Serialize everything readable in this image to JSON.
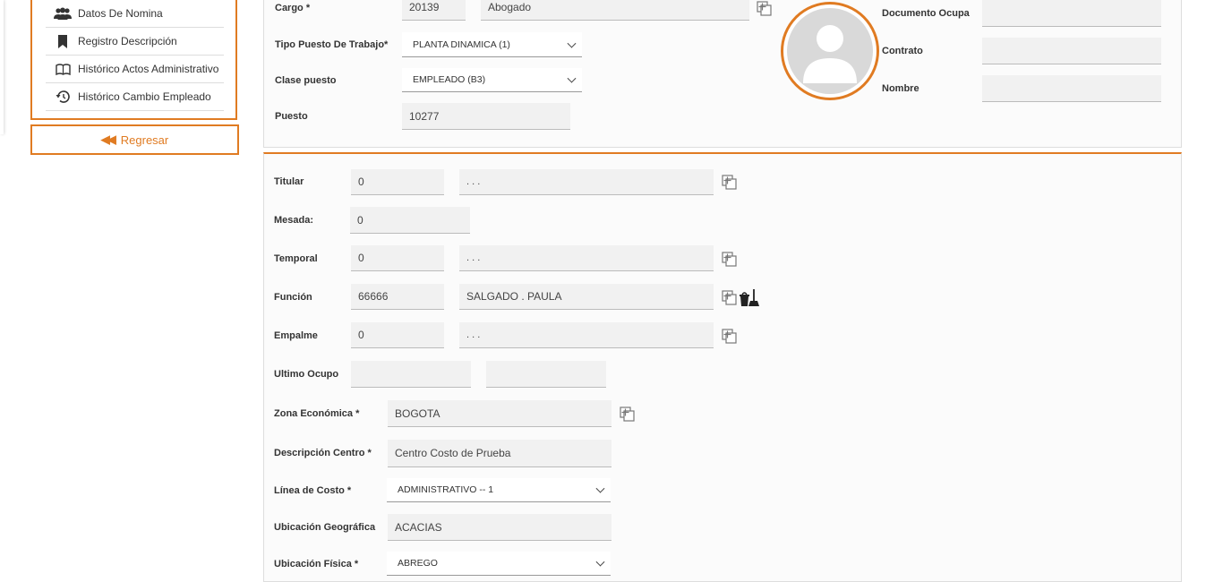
{
  "sidebar": {
    "items": [
      {
        "label": "Datos De Nomina",
        "icon": "users-icon"
      },
      {
        "label": "Registro Descripción",
        "icon": "bookmark-icon"
      },
      {
        "label": "Histórico Actos Administrativo",
        "icon": "book-icon"
      },
      {
        "label": "Histórico Cambio Empleado",
        "icon": "history-icon"
      }
    ],
    "back_label": "Regresar"
  },
  "top": {
    "cargo": {
      "label": "Cargo *",
      "code": "20139",
      "name": "Abogado"
    },
    "tipo_puesto": {
      "label": "Tipo Puesto De Trabajo*",
      "value": "PLANTA DINAMICA (1)"
    },
    "clase_puesto": {
      "label": "Clase puesto",
      "value": "EMPLEADO (B3)"
    },
    "puesto": {
      "label": "Puesto",
      "value": "10277"
    },
    "documento_ocupa": {
      "label": "Documento Ocupa",
      "value": ""
    },
    "contrato": {
      "label": "Contrato",
      "value": ""
    },
    "nombre": {
      "label": "Nombre",
      "value": ""
    }
  },
  "bottom": {
    "titular": {
      "label": "Titular",
      "code": "0",
      "name": ". . ."
    },
    "mesada": {
      "label": "Mesada:",
      "value": "0"
    },
    "temporal": {
      "label": "Temporal",
      "code": "0",
      "name": ". . ."
    },
    "funcion": {
      "label": "Función",
      "code": "66666",
      "name": "SALGADO . PAULA"
    },
    "empalme": {
      "label": "Empalme",
      "code": "0",
      "name": ". . ."
    },
    "ultimo_ocupo": {
      "label": "Ultimo Ocupo",
      "value1": "",
      "value2": ""
    },
    "zona_economica": {
      "label": "Zona Económica *",
      "value": "BOGOTA"
    },
    "descripcion_centro": {
      "label": "Descripción Centro *",
      "value": "Centro Costo de Prueba"
    },
    "linea_costo": {
      "label": "Línea de Costo *",
      "value": "ADMINISTRATIVO -- 1"
    },
    "ubicacion_geografica": {
      "label": "Ubicación Geográfica",
      "value": "ACACIAS"
    },
    "ubicacion_fisica": {
      "label": "Ubicación Física *",
      "value": "ABREGO"
    }
  },
  "colors": {
    "accent": "#e07b22",
    "field_bg": "#f1f1f1"
  }
}
